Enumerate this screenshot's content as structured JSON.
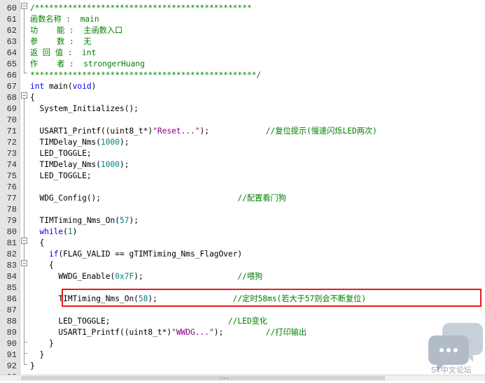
{
  "editor": {
    "lines": [
      {
        "n": "60",
        "parts": [
          {
            "t": "/**********************************************",
            "c": "comment"
          }
        ]
      },
      {
        "n": "61",
        "parts": [
          {
            "t": "函数名称 :  main",
            "c": "comment"
          }
        ]
      },
      {
        "n": "62",
        "parts": [
          {
            "t": "功    能 :  主函数入口",
            "c": "comment"
          }
        ]
      },
      {
        "n": "63",
        "parts": [
          {
            "t": "参    数 :  无",
            "c": "comment"
          }
        ]
      },
      {
        "n": "64",
        "parts": [
          {
            "t": "返 回 值 :  int",
            "c": "comment"
          }
        ]
      },
      {
        "n": "65",
        "parts": [
          {
            "t": "作    者 :  strongerHuang",
            "c": "comment"
          }
        ]
      },
      {
        "n": "66",
        "parts": [
          {
            "t": "************************************************/",
            "c": "comment"
          }
        ]
      },
      {
        "n": "67",
        "parts": [
          {
            "t": "int",
            "c": "kw"
          },
          {
            "t": " main(",
            "c": ""
          },
          {
            "t": "void",
            "c": "kw"
          },
          {
            "t": ")",
            "c": ""
          }
        ]
      },
      {
        "n": "68",
        "parts": [
          {
            "t": "{",
            "c": ""
          }
        ]
      },
      {
        "n": "69",
        "parts": [
          {
            "t": "  System_Initializes();",
            "c": ""
          }
        ]
      },
      {
        "n": "70",
        "parts": []
      },
      {
        "n": "71",
        "parts": [
          {
            "t": "  USART1_Printf((uint8_t*)",
            "c": ""
          },
          {
            "t": "\"Reset...\"",
            "c": "str"
          },
          {
            "t": ");            ",
            "c": ""
          },
          {
            "t": "//复位提示(慢速闪烁LED两次)",
            "c": "comment"
          }
        ]
      },
      {
        "n": "72",
        "parts": [
          {
            "t": "  TIMDelay_Nms(",
            "c": ""
          },
          {
            "t": "1000",
            "c": "num"
          },
          {
            "t": ");",
            "c": ""
          }
        ]
      },
      {
        "n": "73",
        "parts": [
          {
            "t": "  LED_TOGGLE;",
            "c": ""
          }
        ]
      },
      {
        "n": "74",
        "parts": [
          {
            "t": "  TIMDelay_Nms(",
            "c": ""
          },
          {
            "t": "1000",
            "c": "num"
          },
          {
            "t": ");",
            "c": ""
          }
        ]
      },
      {
        "n": "75",
        "parts": [
          {
            "t": "  LED_TOGGLE;",
            "c": ""
          }
        ]
      },
      {
        "n": "76",
        "parts": []
      },
      {
        "n": "77",
        "parts": [
          {
            "t": "  WDG_Config();                             ",
            "c": ""
          },
          {
            "t": "//配置看门狗",
            "c": "comment"
          }
        ]
      },
      {
        "n": "78",
        "parts": []
      },
      {
        "n": "79",
        "parts": [
          {
            "t": "  TIMTiming_Nms_On(",
            "c": ""
          },
          {
            "t": "57",
            "c": "num"
          },
          {
            "t": ");",
            "c": ""
          }
        ]
      },
      {
        "n": "80",
        "parts": [
          {
            "t": "  ",
            "c": ""
          },
          {
            "t": "while",
            "c": "kw"
          },
          {
            "t": "(",
            "c": ""
          },
          {
            "t": "1",
            "c": "num"
          },
          {
            "t": ")",
            "c": ""
          }
        ]
      },
      {
        "n": "81",
        "parts": [
          {
            "t": "  {",
            "c": ""
          }
        ]
      },
      {
        "n": "82",
        "parts": [
          {
            "t": "    ",
            "c": ""
          },
          {
            "t": "if",
            "c": "kw"
          },
          {
            "t": "(FLAG_VALID == gTIMTiming_Nms_FlagOver)",
            "c": ""
          }
        ]
      },
      {
        "n": "83",
        "parts": [
          {
            "t": "    {",
            "c": ""
          }
        ]
      },
      {
        "n": "84",
        "parts": [
          {
            "t": "      WWDG_Enable(",
            "c": ""
          },
          {
            "t": "0x7F",
            "c": "num"
          },
          {
            "t": ");                    ",
            "c": ""
          },
          {
            "t": "//喂狗",
            "c": "comment"
          }
        ]
      },
      {
        "n": "85",
        "parts": []
      },
      {
        "n": "86",
        "parts": [
          {
            "t": "      TIMTiming_Nms_On(",
            "c": ""
          },
          {
            "t": "58",
            "c": "num"
          },
          {
            "t": ");                ",
            "c": ""
          },
          {
            "t": "//定时58ms(若大于57则会不断复位)",
            "c": "comment"
          }
        ]
      },
      {
        "n": "87",
        "parts": []
      },
      {
        "n": "88",
        "parts": [
          {
            "t": "      LED_TOGGLE;                         ",
            "c": ""
          },
          {
            "t": "//LED变化",
            "c": "comment"
          }
        ]
      },
      {
        "n": "89",
        "parts": [
          {
            "t": "      USART1_Printf((uint8_t*)",
            "c": ""
          },
          {
            "t": "\"WWDG...\"",
            "c": "str"
          },
          {
            "t": ");         ",
            "c": ""
          },
          {
            "t": "//打印输出",
            "c": "comment"
          }
        ]
      },
      {
        "n": "90",
        "parts": [
          {
            "t": "    }",
            "c": ""
          }
        ]
      },
      {
        "n": "91",
        "parts": [
          {
            "t": "  }",
            "c": ""
          }
        ]
      },
      {
        "n": "92",
        "parts": [
          {
            "t": "}",
            "c": ""
          }
        ]
      },
      {
        "n": "93",
        "parts": []
      }
    ]
  },
  "colors": {
    "comment": "#008000",
    "keyword": "#0000ff",
    "number": "#008080",
    "string": "#800080",
    "highlight_border": "#e8191e"
  },
  "scrollbar": {
    "grip": "..."
  },
  "watermark": {
    "icon": "chat-bubbles-icon",
    "text": "ST中文论坛"
  }
}
